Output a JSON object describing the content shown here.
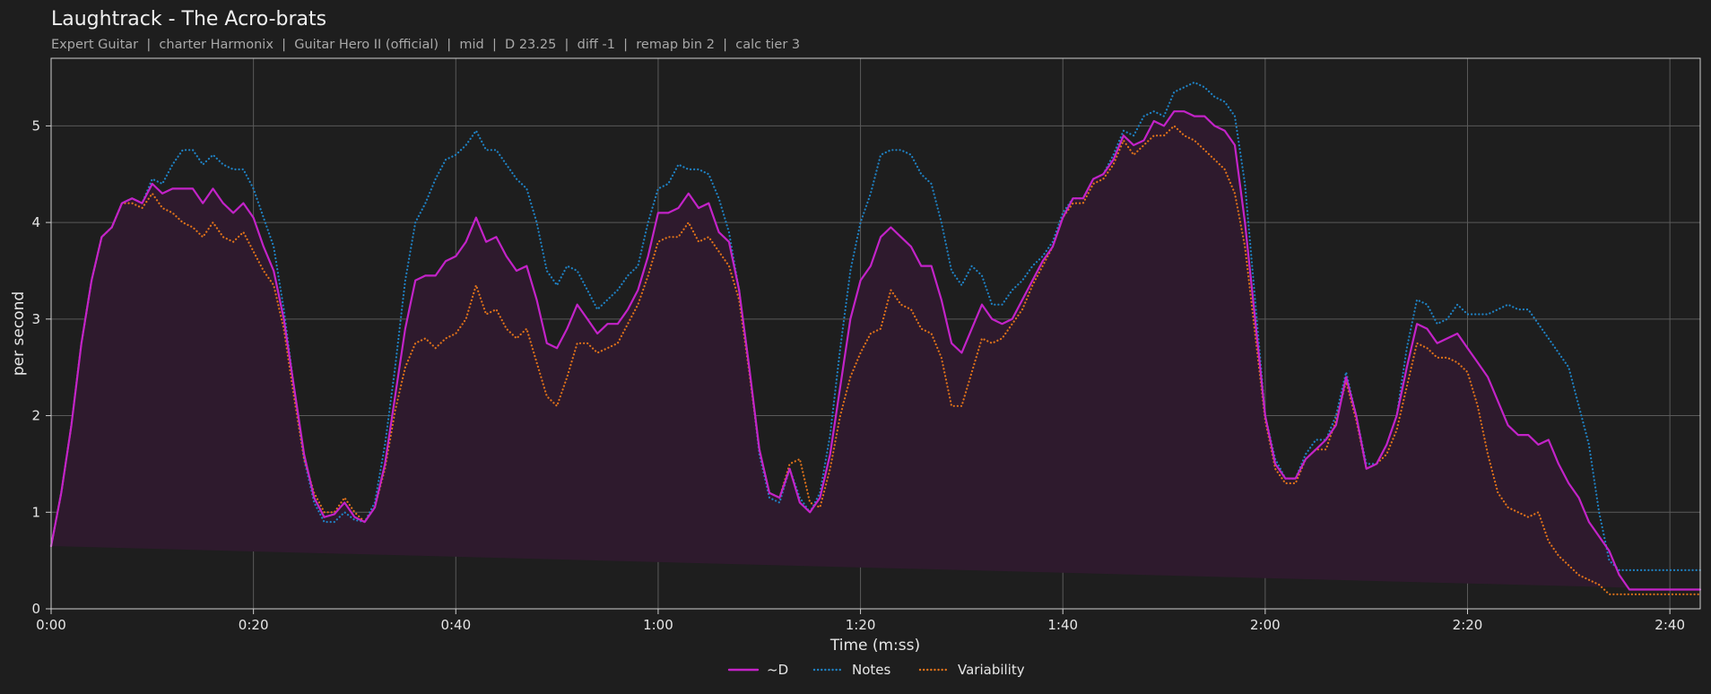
{
  "colors": {
    "background": "#1e1e1e",
    "grid": "#5a5a5a",
    "spine": "#cfcfcf",
    "d": "#c323c8",
    "d_fill": "#2e1a2d",
    "notes": "#1f82c4",
    "variability": "#e0731a"
  },
  "chart_data": {
    "type": "line",
    "title": "Laughtrack - The Acro-brats",
    "subtitle": "Expert Guitar  |  charter Harmonix  |  Guitar Hero II (official)  |  mid  |  D 23.25  |  diff -1  |  remap bin 2  |  calc tier 3",
    "xlabel": "Time (m:ss)",
    "ylabel": "per second",
    "xlim": [
      0,
      163
    ],
    "ylim": [
      0,
      5.7
    ],
    "x_ticks": [
      0,
      20,
      40,
      60,
      80,
      100,
      120,
      140,
      160
    ],
    "x_tick_labels": [
      "0:00",
      "0:20",
      "0:40",
      "1:00",
      "1:20",
      "1:40",
      "2:00",
      "2:20",
      "2:40"
    ],
    "y_ticks": [
      0,
      1,
      2,
      3,
      4,
      5
    ],
    "y_tick_labels": [
      "0",
      "1",
      "2",
      "3",
      "4",
      "5"
    ],
    "grid": true,
    "legend_position": "bottom-center",
    "x": [
      0,
      1,
      2,
      3,
      4,
      5,
      6,
      7,
      8,
      9,
      10,
      11,
      12,
      13,
      14,
      15,
      16,
      17,
      18,
      19,
      20,
      21,
      22,
      23,
      24,
      25,
      26,
      27,
      28,
      29,
      30,
      31,
      32,
      33,
      34,
      35,
      36,
      37,
      38,
      39,
      40,
      41,
      42,
      43,
      44,
      45,
      46,
      47,
      48,
      49,
      50,
      51,
      52,
      53,
      54,
      55,
      56,
      57,
      58,
      59,
      60,
      61,
      62,
      63,
      64,
      65,
      66,
      67,
      68,
      69,
      70,
      71,
      72,
      73,
      74,
      75,
      76,
      77,
      78,
      79,
      80,
      81,
      82,
      83,
      84,
      85,
      86,
      87,
      88,
      89,
      90,
      91,
      92,
      93,
      94,
      95,
      96,
      97,
      98,
      99,
      100,
      101,
      102,
      103,
      104,
      105,
      106,
      107,
      108,
      109,
      110,
      111,
      112,
      113,
      114,
      115,
      116,
      117,
      118,
      119,
      120,
      121,
      122,
      123,
      124,
      125,
      126,
      127,
      128,
      129,
      130,
      131,
      132,
      133,
      134,
      135,
      136,
      137,
      138,
      139,
      140,
      141,
      142,
      143,
      144,
      145,
      146,
      147,
      148,
      149,
      150,
      151,
      152,
      153,
      154,
      155,
      156,
      157,
      158,
      159,
      160,
      161,
      162,
      163
    ],
    "series": [
      {
        "name": "~D",
        "style": "solid",
        "values": [
          0.65,
          1.2,
          1.9,
          2.75,
          3.4,
          3.85,
          3.95,
          4.2,
          4.25,
          4.2,
          4.4,
          4.3,
          4.35,
          4.35,
          4.35,
          4.2,
          4.35,
          4.2,
          4.1,
          4.2,
          4.05,
          3.75,
          3.5,
          3.0,
          2.3,
          1.6,
          1.15,
          0.95,
          0.98,
          1.1,
          0.95,
          0.9,
          1.05,
          1.5,
          2.2,
          2.9,
          3.4,
          3.45,
          3.45,
          3.6,
          3.65,
          3.8,
          4.05,
          3.8,
          3.85,
          3.65,
          3.5,
          3.55,
          3.2,
          2.75,
          2.7,
          2.9,
          3.15,
          3.0,
          2.85,
          2.95,
          2.95,
          3.1,
          3.3,
          3.65,
          4.1,
          4.1,
          4.15,
          4.3,
          4.15,
          4.2,
          3.9,
          3.8,
          3.3,
          2.5,
          1.65,
          1.2,
          1.15,
          1.45,
          1.1,
          1.0,
          1.15,
          1.6,
          2.3,
          3.0,
          3.4,
          3.55,
          3.85,
          3.95,
          3.85,
          3.75,
          3.55,
          3.55,
          3.2,
          2.75,
          2.65,
          2.9,
          3.15,
          3.0,
          2.95,
          3.0,
          3.2,
          3.4,
          3.6,
          3.75,
          4.05,
          4.25,
          4.25,
          4.45,
          4.5,
          4.65,
          4.9,
          4.8,
          4.85,
          5.05,
          5.0,
          5.15,
          5.15,
          5.1,
          5.1,
          5.0,
          4.95,
          4.8,
          4.0,
          3.0,
          2.0,
          1.5,
          1.35,
          1.35,
          1.55,
          1.65,
          1.75,
          1.9,
          2.4,
          2.0,
          1.45,
          1.5,
          1.7,
          2.0,
          2.5,
          2.95,
          2.9,
          2.75,
          2.8,
          2.85,
          2.7,
          2.55,
          2.4,
          2.15,
          1.9,
          1.8,
          1.8,
          1.7,
          1.75,
          1.5,
          1.3,
          1.15,
          0.9,
          0.75,
          0.6,
          0.35,
          0.2,
          0.2,
          0.2,
          0.2,
          0.2,
          0.2,
          0.2,
          0.2,
          0.2,
          0.2,
          0.2,
          0.2,
          0.2
        ]
      },
      {
        "name": "Notes",
        "style": "dotted",
        "values": [
          0.65,
          1.2,
          1.9,
          2.75,
          3.4,
          3.85,
          3.95,
          4.2,
          4.25,
          4.2,
          4.45,
          4.4,
          4.6,
          4.75,
          4.75,
          4.6,
          4.7,
          4.6,
          4.55,
          4.55,
          4.35,
          4.05,
          3.75,
          3.1,
          2.3,
          1.55,
          1.1,
          0.9,
          0.9,
          1.0,
          0.92,
          0.9,
          1.1,
          1.7,
          2.5,
          3.4,
          4.0,
          4.2,
          4.45,
          4.65,
          4.7,
          4.8,
          4.95,
          4.75,
          4.75,
          4.6,
          4.45,
          4.35,
          4.0,
          3.5,
          3.35,
          3.55,
          3.5,
          3.3,
          3.1,
          3.2,
          3.3,
          3.45,
          3.55,
          4.0,
          4.35,
          4.4,
          4.6,
          4.55,
          4.55,
          4.5,
          4.25,
          3.9,
          3.3,
          2.5,
          1.6,
          1.15,
          1.1,
          1.45,
          1.15,
          1.0,
          1.2,
          1.8,
          2.7,
          3.5,
          4.0,
          4.3,
          4.7,
          4.75,
          4.75,
          4.7,
          4.5,
          4.4,
          4.0,
          3.5,
          3.35,
          3.55,
          3.45,
          3.15,
          3.15,
          3.3,
          3.4,
          3.55,
          3.65,
          3.8,
          4.1,
          4.25,
          4.25,
          4.45,
          4.5,
          4.7,
          4.95,
          4.9,
          5.1,
          5.15,
          5.1,
          5.35,
          5.4,
          5.45,
          5.4,
          5.3,
          5.25,
          5.1,
          4.4,
          3.2,
          2.0,
          1.55,
          1.35,
          1.35,
          1.6,
          1.75,
          1.75,
          2.0,
          2.45,
          2.0,
          1.5,
          1.5,
          1.7,
          2.0,
          2.7,
          3.2,
          3.15,
          2.95,
          3.0,
          3.15,
          3.05,
          3.05,
          3.05,
          3.1,
          3.15,
          3.1,
          3.1,
          2.95,
          2.8,
          2.65,
          2.5,
          2.1,
          1.7,
          1.0,
          0.5,
          0.4,
          0.4,
          0.4,
          0.4,
          0.4,
          0.4,
          0.4,
          0.4,
          0.4,
          0.4,
          0.4,
          0.4,
          0.4
        ]
      },
      {
        "name": "Variability",
        "style": "dotted",
        "values": [
          0.65,
          1.2,
          1.9,
          2.75,
          3.4,
          3.85,
          3.95,
          4.2,
          4.2,
          4.15,
          4.3,
          4.15,
          4.1,
          4.0,
          3.95,
          3.85,
          4.0,
          3.85,
          3.8,
          3.9,
          3.7,
          3.5,
          3.35,
          2.9,
          2.2,
          1.55,
          1.2,
          1.0,
          1.0,
          1.15,
          1.0,
          0.9,
          1.05,
          1.45,
          2.05,
          2.5,
          2.75,
          2.8,
          2.7,
          2.8,
          2.85,
          3.0,
          3.35,
          3.05,
          3.1,
          2.9,
          2.8,
          2.9,
          2.55,
          2.2,
          2.1,
          2.4,
          2.75,
          2.75,
          2.65,
          2.7,
          2.75,
          2.95,
          3.15,
          3.45,
          3.8,
          3.85,
          3.85,
          4.0,
          3.8,
          3.85,
          3.7,
          3.55,
          3.2,
          2.45,
          1.65,
          1.2,
          1.15,
          1.5,
          1.55,
          1.1,
          1.05,
          1.45,
          2.0,
          2.4,
          2.65,
          2.85,
          2.9,
          3.3,
          3.15,
          3.1,
          2.9,
          2.85,
          2.6,
          2.1,
          2.1,
          2.45,
          2.8,
          2.75,
          2.8,
          2.95,
          3.1,
          3.35,
          3.55,
          3.75,
          4.05,
          4.2,
          4.2,
          4.4,
          4.45,
          4.6,
          4.85,
          4.7,
          4.8,
          4.9,
          4.9,
          5.0,
          4.9,
          4.85,
          4.75,
          4.65,
          4.55,
          4.3,
          3.75,
          2.85,
          1.95,
          1.45,
          1.3,
          1.3,
          1.55,
          1.65,
          1.65,
          1.95,
          2.35,
          1.95,
          1.45,
          1.5,
          1.6,
          1.85,
          2.3,
          2.75,
          2.7,
          2.6,
          2.6,
          2.55,
          2.45,
          2.1,
          1.6,
          1.2,
          1.05,
          1.0,
          0.95,
          1.0,
          0.7,
          0.55,
          0.45,
          0.35,
          0.3,
          0.25,
          0.15,
          0.15,
          0.15,
          0.15,
          0.15,
          0.15,
          0.15,
          0.15,
          0.15,
          0.15,
          0.15,
          0.15,
          0.15,
          0.15
        ]
      }
    ]
  }
}
